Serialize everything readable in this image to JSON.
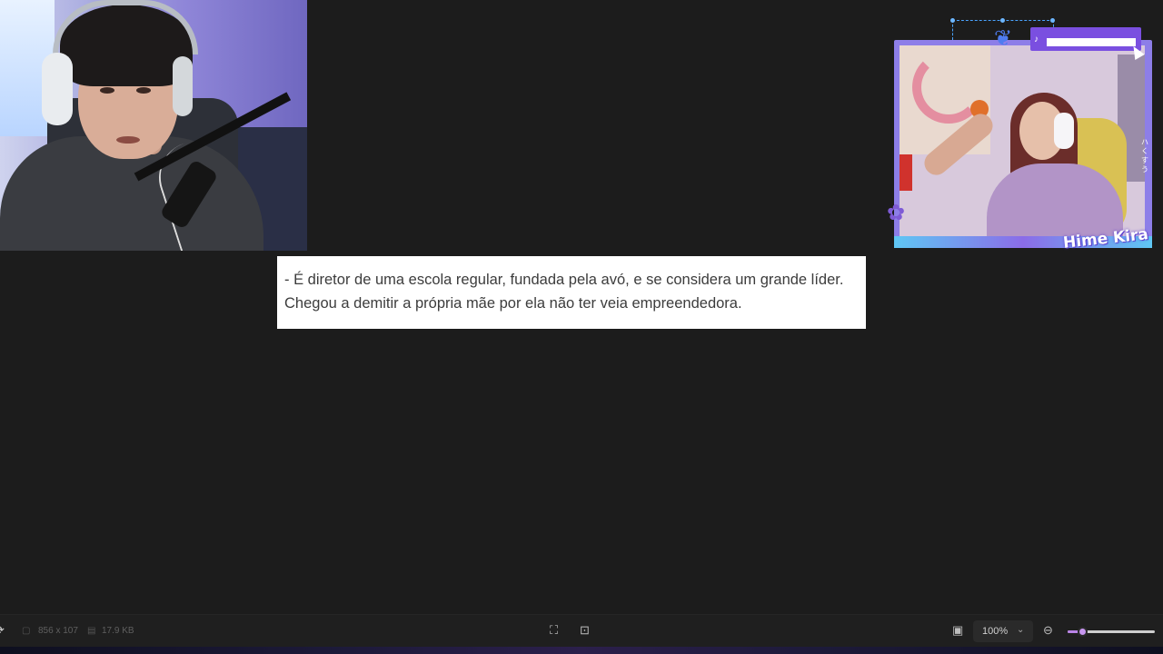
{
  "text_image": {
    "line1": "- É diretor de uma escola regular, fundada pela avó, e se considera um grande líder.",
    "line2": "Chegou a demitir a própria mãe por ela não ter veia empreendedora."
  },
  "overlay": {
    "streamer_logo": "Hime Kira"
  },
  "statusbar": {
    "dimensions": "856 x 107",
    "file_size": "17.9 KB",
    "zoom": "100%",
    "zoom_chevron": "⌄",
    "zoom_fraction": 0.18,
    "icons": {
      "left": "undo-icon",
      "dims": "image-size-icon",
      "size": "file-size-icon",
      "fit": "fit-screen-icon",
      "actual": "actual-size-icon",
      "screen": "screen-icon",
      "zoom_out": "zoom-out-icon"
    }
  },
  "colors": {
    "background": "#1c1c1c",
    "accent": "#b983e6",
    "overlay_frame": "#8d7ee8"
  }
}
